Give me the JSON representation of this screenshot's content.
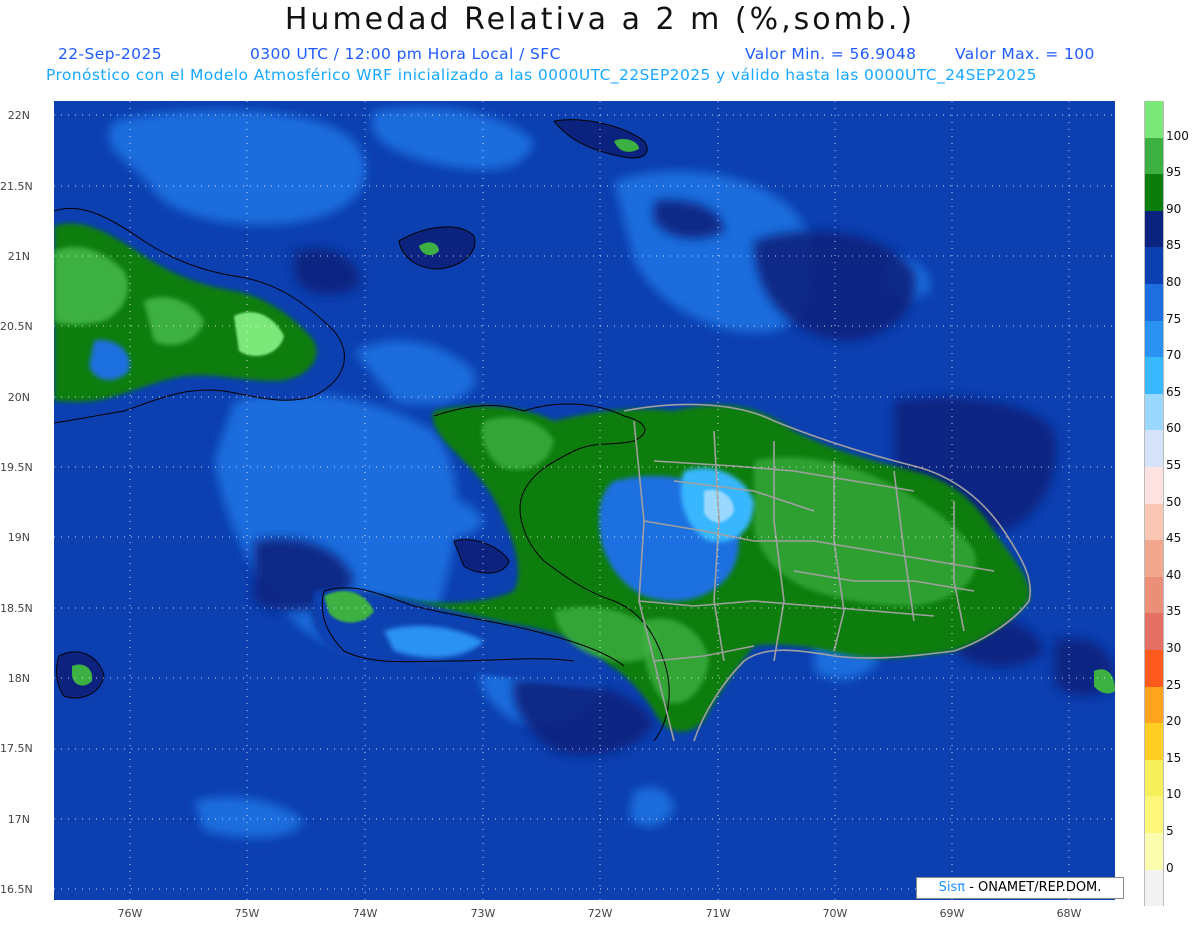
{
  "title": "Humedad Relativa a 2 m (%,somb.)",
  "header": {
    "date": "22-Sep-2025",
    "time": "0300 UTC / 12:00 pm Hora Local / SFC",
    "min": "Valor Min. = 56.9048",
    "max": "Valor Max. = 100",
    "model_line": "Pronóstico con el Modelo Atmosférico WRF inicializado a las 0000UTC_22SEP2025 y válido hasta las  0000UTC_24SEP2025"
  },
  "lat_labels": [
    "22N",
    "21.5N",
    "21N",
    "20.5N",
    "20N",
    "19.5N",
    "19N",
    "18.5N",
    "18N",
    "17.5N",
    "17N",
    "16.5N"
  ],
  "lon_labels": [
    "76W",
    "75W",
    "74W",
    "73W",
    "72W",
    "71W",
    "70W",
    "69W",
    "68W"
  ],
  "colorbar": {
    "labels": [
      "100",
      "95",
      "90",
      "85",
      "80",
      "75",
      "70",
      "65",
      "60",
      "55",
      "50",
      "45",
      "40",
      "35",
      "30",
      "25",
      "20",
      "15",
      "10",
      "5",
      "0"
    ],
    "colors": [
      "#7ce87a",
      "#3cb043",
      "#0a7d0a",
      "#0b237e",
      "#0c3fb0",
      "#1d6fe0",
      "#2a92f2",
      "#39b7ff",
      "#9ad8ff",
      "#d6e2f8",
      "#fde2e2",
      "#f9c7b3",
      "#f2a88e",
      "#ec8f79",
      "#e56f62",
      "#ff5a1e",
      "#ffa41c",
      "#ffcf26",
      "#f5ef5c",
      "#fdf87c",
      "#fdfdb0",
      "#f2f2f2"
    ]
  },
  "credit": {
    "sis": "Sisπ",
    "org": " - ONAMET/REP.DOM."
  }
}
